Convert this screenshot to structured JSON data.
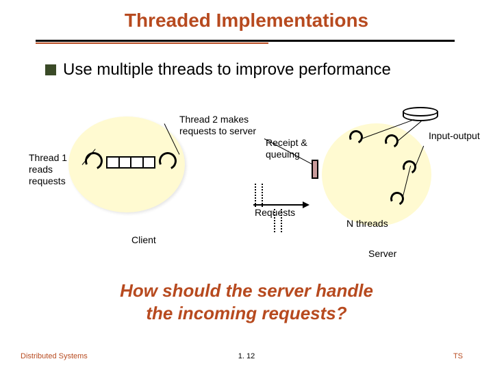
{
  "title": "Threaded Implementations",
  "bullet": "Use multiple threads to improve performance",
  "labels": {
    "thread1": "Thread 1\nreads\nrequests",
    "thread2": "Thread 2 makes\nrequests to server",
    "receipt": "Receipt &\nqueuing",
    "io": "Input-output",
    "requests": "Requests",
    "nthreads": "N threads",
    "client": "Client",
    "server": "Server"
  },
  "question": "How should the server handle\nthe incoming requests?",
  "footer": {
    "left": "Distributed Systems",
    "center": "1. 12",
    "right": "TS"
  }
}
